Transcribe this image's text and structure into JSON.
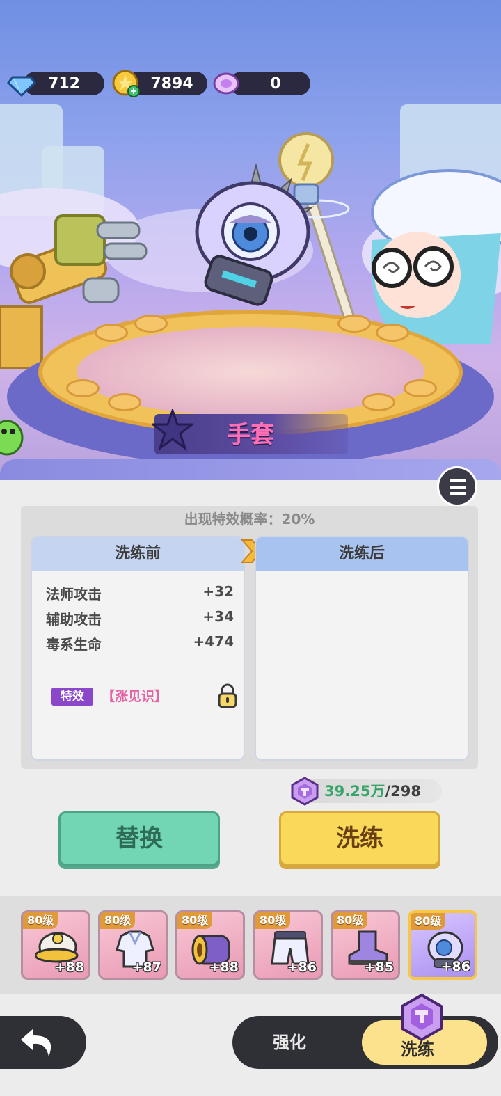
{
  "currency": {
    "diamond": "712",
    "gold": "7894",
    "crystal": "0"
  },
  "item": {
    "name": "手套"
  },
  "refine": {
    "chance_label": "出现特效概率：20%",
    "before_title": "洗练前",
    "after_title": "洗练后",
    "stats": [
      {
        "name": "法师攻击",
        "value": "+32"
      },
      {
        "name": "辅助攻击",
        "value": "+34"
      },
      {
        "name": "毒系生命",
        "value": "+474"
      }
    ],
    "effect_tag": "特效",
    "effect_name": "【涨见识】"
  },
  "cost": {
    "have": "39.25万",
    "separator": "/",
    "need": "298"
  },
  "buttons": {
    "replace": "替换",
    "refine": "洗练"
  },
  "equipment": [
    {
      "level": "80级",
      "plus": "+88",
      "icon": "helmet-icon"
    },
    {
      "level": "80级",
      "plus": "+87",
      "icon": "armor-icon"
    },
    {
      "level": "80级",
      "plus": "+88",
      "icon": "bracer-icon"
    },
    {
      "level": "80级",
      "plus": "+86",
      "icon": "pants-icon"
    },
    {
      "level": "80级",
      "plus": "+85",
      "icon": "boots-icon"
    },
    {
      "level": "80级",
      "plus": "+86",
      "icon": "glove-icon",
      "selected": true
    }
  ],
  "nav": {
    "strengthen": "强化",
    "refine": "洗练"
  },
  "colors": {
    "replace_button": "#72d6b4",
    "refine_button": "#fad95a",
    "item_name": "#ff6fb5",
    "effect_tag": "#8b47c9",
    "effect_name": "#e664a6",
    "cost_have": "#37a56a"
  }
}
